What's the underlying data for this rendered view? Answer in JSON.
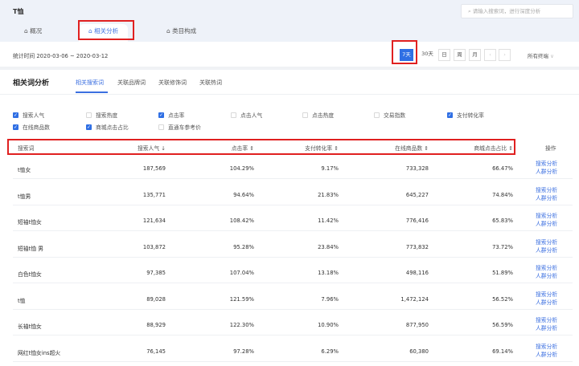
{
  "header": {
    "title": "T恤",
    "search_placeholder": "请输入搜索词，进行深度分析"
  },
  "tabs": [
    {
      "label": "概况"
    },
    {
      "label": "相关分析"
    },
    {
      "label": "类目构成"
    }
  ],
  "date_bar": {
    "stat_time": "统计时间 2020-03-06 ~ 2020-03-12",
    "periods": [
      "7天",
      "30天",
      "日",
      "周",
      "月"
    ],
    "prev": "‹",
    "next": "›",
    "terminal": "所有终端",
    "chevron": "∨"
  },
  "section": {
    "title": "相关词分析",
    "subtabs": [
      "相关搜索词",
      "关联品牌词",
      "关联修饰词",
      "关联热词"
    ]
  },
  "metrics": [
    {
      "label": "搜索人气",
      "checked": true
    },
    {
      "label": "搜索热度",
      "checked": false
    },
    {
      "label": "点击率",
      "checked": true
    },
    {
      "label": "点击人气",
      "checked": false
    },
    {
      "label": "点击热度",
      "checked": false
    },
    {
      "label": "交易指数",
      "checked": false
    },
    {
      "label": "支付转化率",
      "checked": true
    },
    {
      "label": "在线商品数",
      "checked": true
    },
    {
      "label": "商城点击占比",
      "checked": true
    },
    {
      "label": "直通车参考价",
      "checked": false
    }
  ],
  "table": {
    "headers": [
      "搜索词",
      "搜索人气 ↓",
      "点击率 ⇕",
      "支付转化率 ⇕",
      "在线商品数 ⇕",
      "商城点击占比 ⇕",
      "操作"
    ],
    "action1": "搜索分析",
    "action2": "人群分析",
    "rows": [
      [
        "t恤女",
        "187,569",
        "104.29%",
        "9.17%",
        "733,328",
        "66.47%"
      ],
      [
        "t恤男",
        "135,771",
        "94.64%",
        "21.83%",
        "645,227",
        "74.84%"
      ],
      [
        "短袖t恤女",
        "121,634",
        "108.42%",
        "11.42%",
        "776,416",
        "65.83%"
      ],
      [
        "短袖t恤 男",
        "103,872",
        "95.28%",
        "23.84%",
        "773,832",
        "73.72%"
      ],
      [
        "白色t恤女",
        "97,385",
        "107.04%",
        "13.18%",
        "498,116",
        "51.89%"
      ],
      [
        "t恤",
        "89,028",
        "121.59%",
        "7.96%",
        "1,472,124",
        "56.52%"
      ],
      [
        "长袖t恤女",
        "88,929",
        "122.30%",
        "10.90%",
        "877,950",
        "56.59%"
      ],
      [
        "网红t恤女ins超火",
        "76,145",
        "97.28%",
        "6.29%",
        "60,380",
        "69.14%"
      ]
    ]
  }
}
